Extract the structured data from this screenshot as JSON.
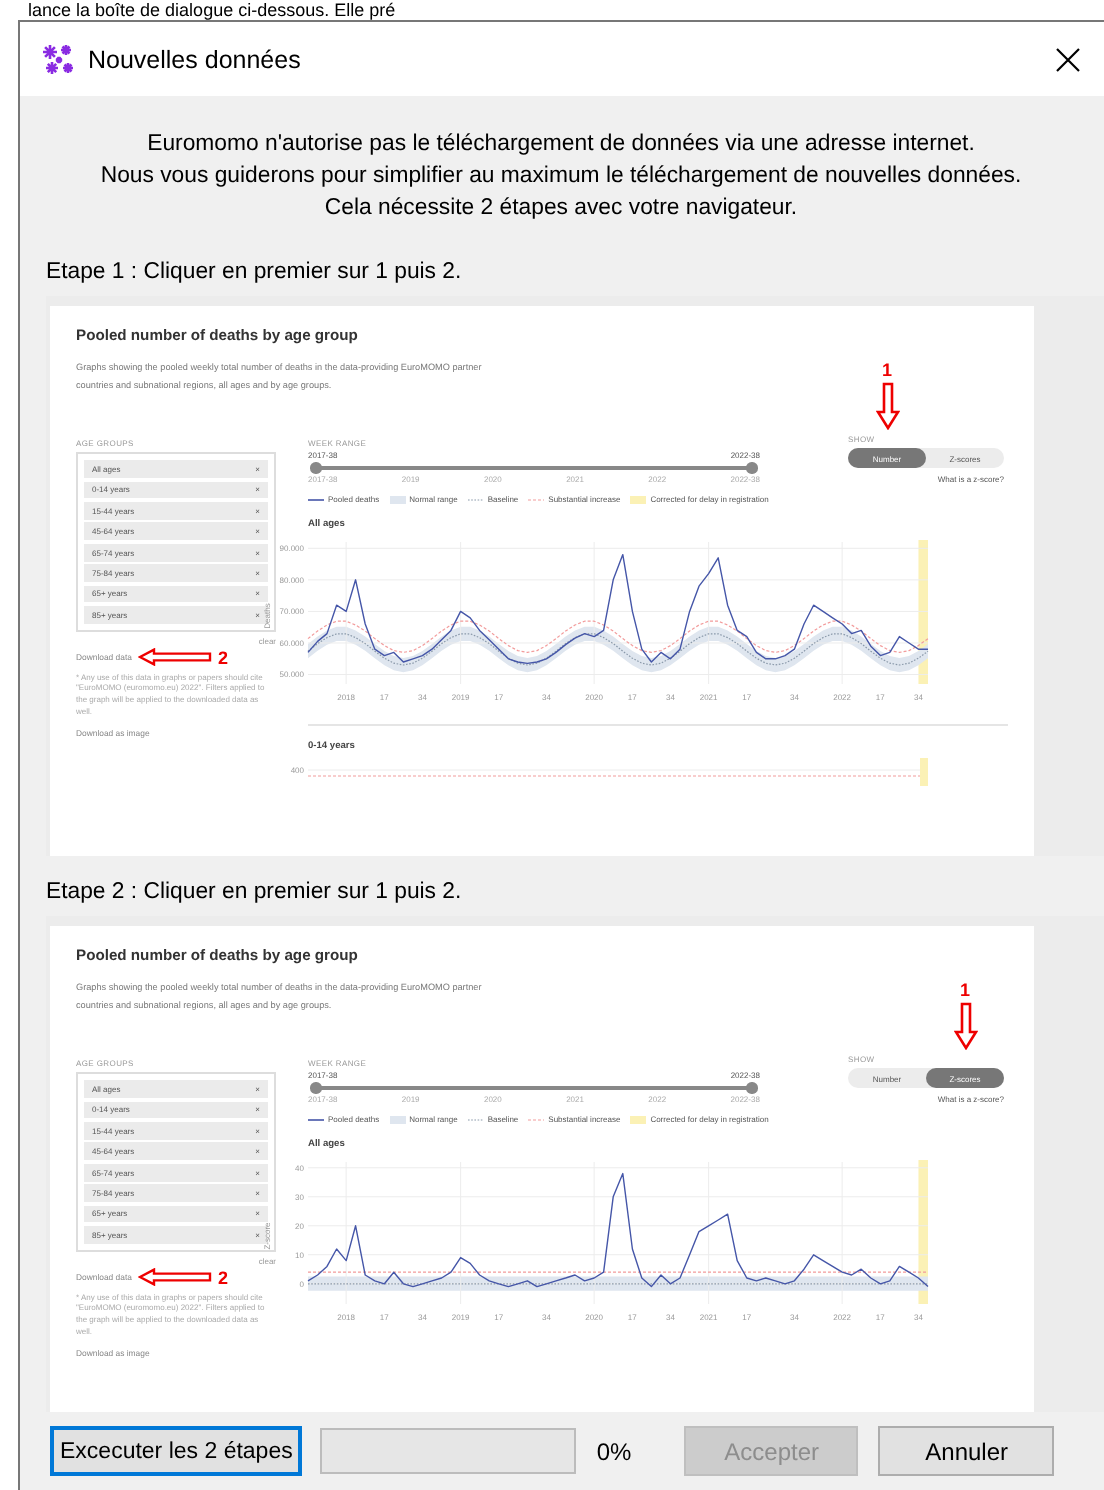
{
  "background_text": "lance la boîte de dialogue ci-dessous. Elle pré",
  "window": {
    "title": "Nouvelles données"
  },
  "intro": [
    "Euromomo n'autorise pas le téléchargement de données via une adresse internet.",
    "Nous vous guiderons pour simplifier au maximum le téléchargement de nouvelles données.",
    "Cela nécessite 2 étapes avec votre navigateur."
  ],
  "steps": [
    {
      "label": "Etape 1 : Cliquer en premier sur 1 puis 2.",
      "screenshot": {
        "title": "Pooled number of deaths by age group",
        "description": "Graphs showing the pooled weekly total number of deaths in the data-providing EuroMOMO partner countries and subnational regions, all ages and by age groups.",
        "age_groups": {
          "label": "AGE GROUPS",
          "items": [
            "All ages",
            "0-14 years",
            "15-44 years",
            "45-64 years",
            "65-74 years",
            "75-84 years",
            "65+ years",
            "85+ years"
          ],
          "remove": "×",
          "clear": "clear"
        },
        "download_data": {
          "label": "Download data",
          "marker": "2"
        },
        "note": "* Any use of this data in graphs or papers should cite \"EuroMOMO (euromomo.eu) 2022\". Filters applied to the graph will be applied to the downloaded data as well.",
        "download_image": "Download as image",
        "week_range": {
          "label": "WEEK RANGE",
          "start": "2017-38",
          "end": "2022-38",
          "level": 1,
          "ticks": [
            "2017-38",
            "2019",
            "2020",
            "2021",
            "2022",
            "2022-38"
          ]
        },
        "show": {
          "label": "SHOW",
          "options": [
            {
              "label": "Number",
              "selected": true,
              "marker": "1"
            },
            {
              "label": "Z-scores",
              "selected": false
            }
          ],
          "help": "What is a z-score?"
        },
        "legend": [
          {
            "label": "Pooled deaths",
            "kind": "line"
          },
          {
            "label": "Normal range",
            "kind": "band"
          },
          {
            "label": "Baseline",
            "kind": "dotted"
          },
          {
            "label": "Substantial increase",
            "kind": "dashed"
          },
          {
            "label": "Corrected for delay in registration",
            "kind": "highlight"
          }
        ],
        "panels": [
          {
            "title": "All ages",
            "kind": "chart",
            "chart_data": {
              "type": "line",
              "ylabel": "Deaths",
              "categories": [
                null,
                null,
                null,
                null,
                "2018",
                null,
                null,
                null,
                "17",
                null,
                null,
                null,
                "34",
                null,
                null,
                null,
                "2019",
                null,
                null,
                null,
                "17",
                null,
                null,
                null,
                null,
                "34",
                null,
                null,
                null,
                null,
                "2020",
                null,
                null,
                null,
                "17",
                null,
                null,
                null,
                "34",
                null,
                null,
                null,
                "2021",
                null,
                null,
                null,
                "17",
                null,
                null,
                null,
                null,
                "34",
                null,
                null,
                null,
                null,
                "2022",
                null,
                null,
                null,
                "17",
                null,
                null,
                null,
                "34",
                null
              ],
              "ylim": [
                47000,
                92000
              ],
              "grid": true,
              "yticks": [
                {
                  "value": 90000,
                  "label": "90.000"
                },
                {
                  "value": 80000,
                  "label": "80.000"
                },
                {
                  "value": 70000,
                  "label": "70.000"
                },
                {
                  "value": 60000,
                  "label": "60.000"
                },
                {
                  "value": 50000,
                  "label": "50.000"
                }
              ],
              "series": [
                {
                  "color": "#4556a8",
                  "line_style": "solid",
                  "values": [
                    57000,
                    60500,
                    63000,
                    72000,
                    70000,
                    80000,
                    66000,
                    58000,
                    56000,
                    57000,
                    54000,
                    55000,
                    56000,
                    58000,
                    61000,
                    64000,
                    70000,
                    68000,
                    64000,
                    61000,
                    58000,
                    55000,
                    54000,
                    53500,
                    54000,
                    55000,
                    57000,
                    59500,
                    61500,
                    63000,
                    62000,
                    64000,
                    80000,
                    88000,
                    70000,
                    58000,
                    54000,
                    57000,
                    55000,
                    58000,
                    70000,
                    78000,
                    82000,
                    87000,
                    72000,
                    64000,
                    62000,
                    57000,
                    55000,
                    55000,
                    56000,
                    58000,
                    66000,
                    72000,
                    70000,
                    68000,
                    66000,
                    63000,
                    64000,
                    59000,
                    56000,
                    57000,
                    62000,
                    60000,
                    58000,
                    58000
                  ]
                },
                {
                  "color": "#8a99aa",
                  "line_style": "dotted",
                  "values": [
                    57400,
                    59800,
                    61700,
                    62900,
                    62900,
                    61700,
                    59800,
                    57400,
                    55200,
                    53600,
                    53000,
                    53600,
                    55200,
                    57400,
                    59800,
                    61700,
                    62900,
                    62900,
                    61700,
                    59800,
                    57400,
                    55200,
                    53600,
                    53000,
                    53600,
                    55200,
                    57400,
                    59800,
                    61700,
                    62900,
                    62900,
                    61700,
                    59800,
                    57400,
                    55200,
                    53600,
                    53000,
                    53600,
                    55200,
                    57400,
                    59800,
                    61700,
                    62900,
                    62900,
                    61700,
                    59800,
                    57400,
                    55200,
                    53600,
                    53000,
                    53600,
                    55200,
                    57400,
                    59800,
                    61700,
                    62900,
                    62900,
                    61700,
                    59800,
                    57400,
                    55200,
                    53600,
                    53000,
                    53600,
                    55200,
                    57400
                  ]
                },
                {
                  "color": "#f29b9b",
                  "line_style": "dashed",
                  "values": [
                    61400,
                    63800,
                    65700,
                    66900,
                    66900,
                    65700,
                    63800,
                    61400,
                    59200,
                    57600,
                    57000,
                    57600,
                    59200,
                    61400,
                    63800,
                    65700,
                    66900,
                    66900,
                    65700,
                    63800,
                    61400,
                    59200,
                    57600,
                    57000,
                    57600,
                    59200,
                    61400,
                    63800,
                    65700,
                    66900,
                    66900,
                    65700,
                    63800,
                    61400,
                    59200,
                    57600,
                    57000,
                    57600,
                    59200,
                    61400,
                    63800,
                    65700,
                    66900,
                    66900,
                    65700,
                    63800,
                    61400,
                    59200,
                    57600,
                    57000,
                    57600,
                    59200,
                    61400,
                    63800,
                    65700,
                    66900,
                    66900,
                    65700,
                    63800,
                    61400,
                    59200,
                    57600,
                    57000,
                    57600,
                    59200,
                    61400
                  ]
                }
              ]
            }
          },
          {
            "title": "0-14 years",
            "kind": "cut",
            "ytick": "400"
          }
        ]
      }
    },
    {
      "label": "Etape 2 : Cliquer en premier sur 1 puis 2.",
      "screenshot": {
        "title": "Pooled number of deaths by age group",
        "description": "Graphs showing the pooled weekly total number of deaths in the data-providing EuroMOMO partner countries and subnational regions, all ages and by age groups.",
        "age_groups": {
          "label": "AGE GROUPS",
          "items": [
            "All ages",
            "0-14 years",
            "15-44 years",
            "45-64 years",
            "65-74 years",
            "75-84 years",
            "65+ years",
            "85+ years"
          ],
          "remove": "×",
          "clear": "clear"
        },
        "download_data": {
          "label": "Download data",
          "marker": "2"
        },
        "note": "* Any use of this data in graphs or papers should cite \"EuroMOMO (euromomo.eu) 2022\". Filters applied to the graph will be applied to the downloaded data as well.",
        "download_image": "Download as image",
        "week_range": {
          "label": "WEEK RANGE",
          "start": "2017-38",
          "end": "2022-38",
          "level": 1,
          "ticks": [
            "2017-38",
            "2019",
            "2020",
            "2021",
            "2022",
            "2022-38"
          ]
        },
        "show": {
          "label": "SHOW",
          "options": [
            {
              "label": "Number",
              "selected": false
            },
            {
              "label": "Z-scores",
              "selected": true,
              "marker": "1"
            }
          ],
          "help": "What is a z-score?"
        },
        "legend": [
          {
            "label": "Pooled deaths",
            "kind": "line"
          },
          {
            "label": "Normal range",
            "kind": "band"
          },
          {
            "label": "Baseline",
            "kind": "dotted"
          },
          {
            "label": "Substantial increase",
            "kind": "dashed"
          },
          {
            "label": "Corrected for delay in registration",
            "kind": "highlight"
          }
        ],
        "panels": [
          {
            "title": "All ages",
            "kind": "chart",
            "chart_data": {
              "type": "line",
              "ylabel": "Z-score",
              "categories": [
                null,
                null,
                null,
                null,
                "2018",
                null,
                null,
                null,
                "17",
                null,
                null,
                null,
                "34",
                null,
                null,
                null,
                "2019",
                null,
                null,
                null,
                "17",
                null,
                null,
                null,
                null,
                "34",
                null,
                null,
                null,
                null,
                "2020",
                null,
                null,
                null,
                "17",
                null,
                null,
                null,
                "34",
                null,
                null,
                null,
                "2021",
                null,
                null,
                null,
                "17",
                null,
                null,
                null,
                null,
                "34",
                null,
                null,
                null,
                null,
                "2022",
                null,
                null,
                null,
                "17",
                null,
                null,
                null,
                "34",
                null
              ],
              "ylim": [
                -7,
                42
              ],
              "grid": true,
              "yticks": [
                40,
                30,
                20,
                10,
                0
              ],
              "series": [
                {
                  "color": "#4556a8",
                  "line_style": "solid",
                  "values": [
                    1,
                    3,
                    6,
                    12,
                    8,
                    20,
                    3,
                    1,
                    0,
                    4,
                    0,
                    -1,
                    0,
                    1,
                    2,
                    4,
                    9,
                    7,
                    3,
                    1,
                    0,
                    -1,
                    0,
                    1,
                    -1,
                    0,
                    1,
                    2,
                    3,
                    1,
                    2,
                    4,
                    30,
                    38,
                    12,
                    2,
                    -1,
                    3,
                    0,
                    2,
                    10,
                    18,
                    20,
                    22,
                    24,
                    8,
                    2,
                    1,
                    2,
                    1,
                    0,
                    1,
                    5,
                    10,
                    8,
                    6,
                    4,
                    3,
                    5,
                    2,
                    0,
                    1,
                    6,
                    4,
                    2,
                    -1
                  ]
                },
                {
                  "color": "#8a99aa",
                  "line_style": "dotted",
                  "values": [
                    0,
                    0,
                    0,
                    0,
                    0,
                    0,
                    0,
                    0,
                    0,
                    0,
                    0,
                    0,
                    0,
                    0,
                    0,
                    0,
                    0,
                    0,
                    0,
                    0,
                    0,
                    0,
                    0,
                    0,
                    0,
                    0,
                    0,
                    0,
                    0,
                    0,
                    0,
                    0,
                    0,
                    0,
                    0,
                    0,
                    0,
                    0,
                    0,
                    0,
                    0,
                    0,
                    0,
                    0,
                    0,
                    0,
                    0,
                    0,
                    0,
                    0,
                    0,
                    0,
                    0,
                    0,
                    0,
                    0,
                    0,
                    0,
                    0,
                    0,
                    0,
                    0,
                    0,
                    0,
                    0,
                    0
                  ]
                },
                {
                  "color": "#f29b9b",
                  "line_style": "dashed",
                  "values": [
                    4,
                    4,
                    4,
                    4,
                    4,
                    4,
                    4,
                    4,
                    4,
                    4,
                    4,
                    4,
                    4,
                    4,
                    4,
                    4,
                    4,
                    4,
                    4,
                    4,
                    4,
                    4,
                    4,
                    4,
                    4,
                    4,
                    4,
                    4,
                    4,
                    4,
                    4,
                    4,
                    4,
                    4,
                    4,
                    4,
                    4,
                    4,
                    4,
                    4,
                    4,
                    4,
                    4,
                    4,
                    4,
                    4,
                    4,
                    4,
                    4,
                    4,
                    4,
                    4,
                    4,
                    4,
                    4,
                    4,
                    4,
                    4,
                    4,
                    4,
                    4,
                    4,
                    4,
                    4,
                    4,
                    4
                  ]
                }
              ]
            }
          }
        ]
      }
    }
  ],
  "footer": {
    "run_button": {
      "label": "Excecuter les 2 étapes",
      "focused": true
    },
    "progress": {
      "level": 0,
      "reading": "0%"
    },
    "accept_button": {
      "label": "Accepter",
      "disabled": true
    },
    "cancel_button": {
      "label": "Annuler"
    }
  }
}
